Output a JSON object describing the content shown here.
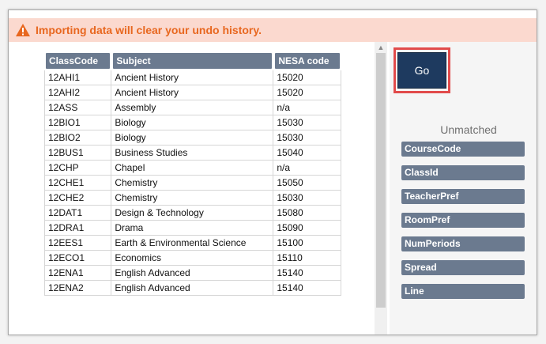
{
  "warning": {
    "text": "Importing data will clear your undo history."
  },
  "table": {
    "headers": [
      "ClassCode",
      "Subject",
      "NESA code"
    ],
    "rows": [
      [
        "12AHI1",
        "Ancient History",
        "15020"
      ],
      [
        "12AHI2",
        "Ancient History",
        "15020"
      ],
      [
        "12ASS",
        "Assembly",
        "n/a"
      ],
      [
        "12BIO1",
        "Biology",
        "15030"
      ],
      [
        "12BIO2",
        "Biology",
        "15030"
      ],
      [
        "12BUS1",
        "Business Studies",
        "15040"
      ],
      [
        "12CHP",
        "Chapel",
        "n/a"
      ],
      [
        "12CHE1",
        "Chemistry",
        "15050"
      ],
      [
        "12CHE2",
        "Chemistry",
        "15030"
      ],
      [
        "12DAT1",
        "Design & Technology",
        "15080"
      ],
      [
        "12DRA1",
        "Drama",
        "15090"
      ],
      [
        "12EES1",
        "Earth & Environmental Science",
        "15100"
      ],
      [
        "12ECO1",
        "Economics",
        "15110"
      ],
      [
        "12ENA1",
        "English Advanced",
        "15140"
      ],
      [
        "12ENA2",
        "English Advanced",
        "15140"
      ]
    ]
  },
  "go_button": {
    "label": "Go"
  },
  "unmatched": {
    "label": "Unmatched",
    "fields": [
      "CourseCode",
      "ClassId",
      "TeacherPref",
      "RoomPref",
      "NumPeriods",
      "Spread",
      "Line"
    ]
  },
  "colors": {
    "warning_bg": "#fbd9cf",
    "warning_text": "#e8671f",
    "header_bg": "#6b7a8f",
    "go_bg": "#1e3a5f",
    "highlight": "#e14b4b"
  }
}
